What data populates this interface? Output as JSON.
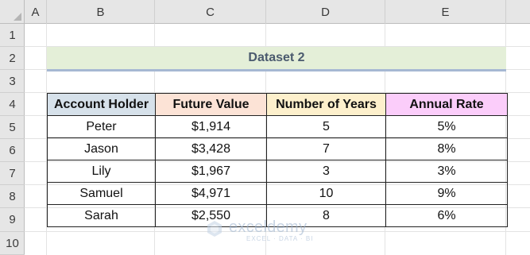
{
  "columns": [
    "A",
    "B",
    "C",
    "D",
    "E"
  ],
  "rows": [
    "1",
    "2",
    "3",
    "4",
    "5",
    "6",
    "7",
    "8",
    "9",
    "10"
  ],
  "title": "Dataset 2",
  "table": {
    "headers": [
      "Account Holder",
      "Future Value",
      "Number of Years",
      "Annual Rate"
    ],
    "rows": [
      [
        "Peter",
        "$1,914",
        "5",
        "5%"
      ],
      [
        "Jason",
        "$3,428",
        "7",
        "8%"
      ],
      [
        "Lily",
        "$1,967",
        "3",
        "3%"
      ],
      [
        "Samuel",
        "$4,971",
        "10",
        "9%"
      ],
      [
        "Sarah",
        "$2,550",
        "8",
        "6%"
      ]
    ]
  },
  "watermark": {
    "name": "exceldemy",
    "tagline": "EXCEL · DATA · BI"
  },
  "colors": {
    "title_band": "#e4efd8",
    "title_rule": "#a6b8d3",
    "header_account": "#d6e1ea",
    "header_future": "#fce3d6",
    "header_years": "#fdf0cc",
    "header_rate": "#fbcdfa"
  }
}
